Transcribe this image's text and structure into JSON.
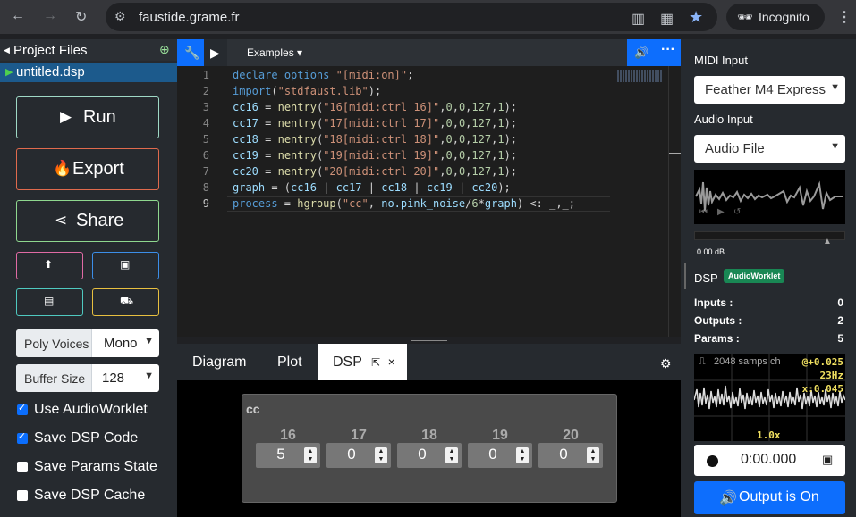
{
  "browser": {
    "url": "faustide.grame.fr",
    "profile": "Incognito",
    "back_icon": "←",
    "forward_icon": "→",
    "reload_icon": "↻"
  },
  "left": {
    "project_files": "Project Files",
    "file": "untitled.dsp",
    "run": "Run",
    "export": "Export",
    "share": "Share",
    "poly_label": "Poly Voices",
    "poly_value": "Mono",
    "buffer_label": "Buffer Size",
    "buffer_value": "128",
    "checks": [
      {
        "label": "Use AudioWorklet",
        "checked": true
      },
      {
        "label": "Save DSP Code",
        "checked": true
      },
      {
        "label": "Save Params State",
        "checked": false
      },
      {
        "label": "Save DSP Cache",
        "checked": false
      }
    ]
  },
  "toolbar": {
    "examples": "Examples"
  },
  "editor": {
    "line_numbers": [
      "1",
      "2",
      "3",
      "4",
      "5",
      "6",
      "7",
      "8",
      "9"
    ],
    "lines": [
      "declare options \"[midi:on]\";",
      "import(\"stdfaust.lib\");",
      "cc16 = nentry(\"16[midi:ctrl 16]\",0,0,127,1);",
      "cc17 = nentry(\"17[midi:ctrl 17]\",0,0,127,1);",
      "cc18 = nentry(\"18[midi:ctrl 18]\",0,0,127,1);",
      "cc19 = nentry(\"19[midi:ctrl 19]\",0,0,127,1);",
      "cc20 = nentry(\"20[midi:ctrl 20]\",0,0,127,1);",
      "graph = (cc16 | cc17 | cc18 | cc19 | cc20);",
      "process = hgroup(\"cc\", no.pink_noise/6*graph) <: _,_;"
    ]
  },
  "tabs": {
    "diagram": "Diagram",
    "plot": "Plot",
    "dsp": "DSP",
    "close": "×"
  },
  "ui": {
    "group": "cc",
    "knobs": [
      {
        "label": "16",
        "value": "5"
      },
      {
        "label": "17",
        "value": "0"
      },
      {
        "label": "18",
        "value": "0"
      },
      {
        "label": "19",
        "value": "0"
      },
      {
        "label": "20",
        "value": "0"
      }
    ]
  },
  "right": {
    "midi_label": "MIDI Input",
    "midi_value": "Feather M4 Express",
    "audio_label": "Audio Input",
    "audio_value": "Audio File",
    "db": "0.00 dB",
    "dsp": "DSP",
    "badge": "AudioWorklet",
    "inputs_label": "Inputs :",
    "inputs": "0",
    "outputs_label": "Outputs :",
    "outputs": "2",
    "params_label": "Params :",
    "params": "5",
    "scope_info": "2048 samps ch",
    "m1": "@+0.025",
    "m2": "23Hz",
    "m3": "x:0.045",
    "zoom": "1.0x",
    "time": "0:00.000",
    "output": "Output is On"
  }
}
